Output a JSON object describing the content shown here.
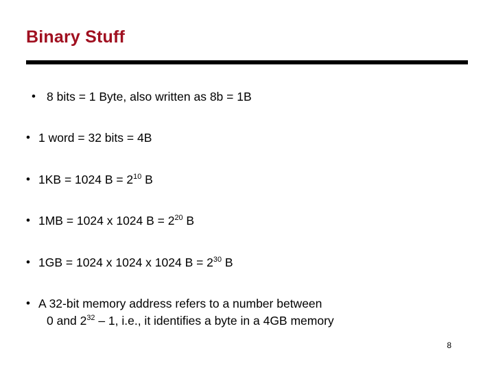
{
  "slide": {
    "title": "Binary Stuff",
    "page_number": "8",
    "bullet_marker": "•",
    "accent_color": "#a01020",
    "rule_color": "#000000",
    "bullets": [
      {
        "parts": [
          {
            "t": "text",
            "v": " 8 bits = 1 Byte, also written as 8b = 1B"
          }
        ]
      },
      {
        "parts": [
          {
            "t": "text",
            "v": "1 word = 32 bits = 4B"
          }
        ]
      },
      {
        "parts": [
          {
            "t": "text",
            "v": "1KB = 1024 B = 2"
          },
          {
            "t": "sup",
            "v": "10"
          },
          {
            "t": "text",
            "v": " B"
          }
        ]
      },
      {
        "parts": [
          {
            "t": "text",
            "v": "1MB = 1024 x 1024 B = 2"
          },
          {
            "t": "sup",
            "v": "20"
          },
          {
            "t": "text",
            "v": " B"
          }
        ]
      },
      {
        "parts": [
          {
            "t": "text",
            "v": "1GB = 1024 x 1024 x 1024 B = 2"
          },
          {
            "t": "sup",
            "v": "30"
          },
          {
            "t": "text",
            "v": " B"
          }
        ]
      },
      {
        "parts": [
          {
            "t": "text",
            "v": "A 32-bit memory address refers to a number between"
          },
          {
            "t": "br",
            "v": ""
          },
          {
            "t": "text",
            "v": "0 and 2"
          },
          {
            "t": "sup",
            "v": "32"
          },
          {
            "t": "text",
            "v": " – 1, i.e., it identifies a byte in a 4GB memory"
          }
        ]
      }
    ]
  }
}
